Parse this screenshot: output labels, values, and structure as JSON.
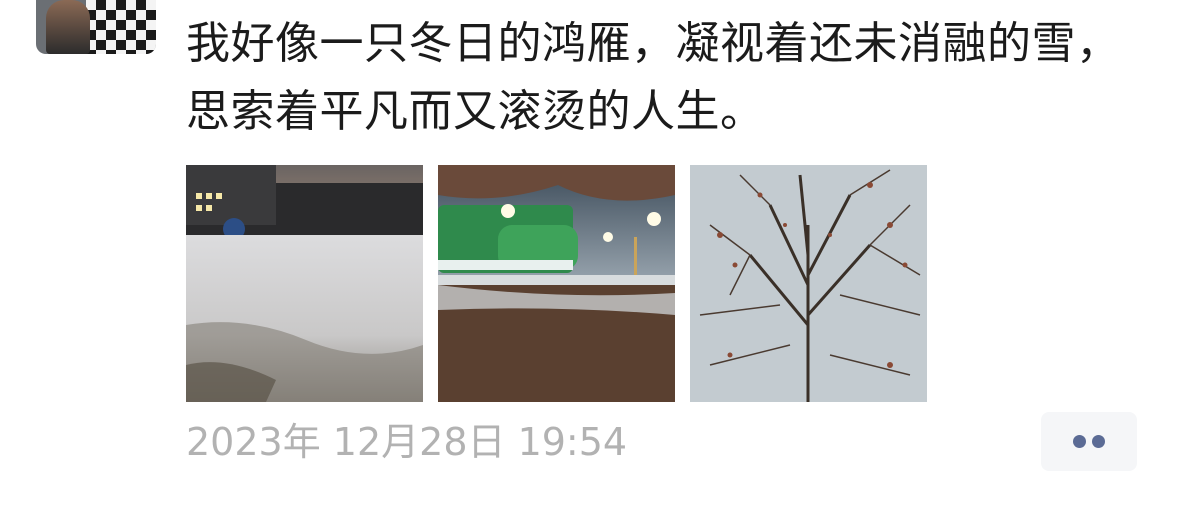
{
  "post": {
    "text": "我好像一只冬日的鸿雁，凝视着还未消融的雪，思索着平凡而又滚烫的人生。",
    "timestamp": "2023年 12月28日 19:54",
    "photos": [
      {
        "subject": "snowy-field-dusk"
      },
      {
        "subject": "park-lamps-snow"
      },
      {
        "subject": "bare-tree-sky"
      }
    ]
  },
  "actions": {
    "more_icon": "two-dots-icon",
    "accent_color": "#5b6b95"
  },
  "colors": {
    "text": "#1b1b1b",
    "timestamp": "#b2b2b2",
    "more_bg": "#f5f6f8"
  }
}
